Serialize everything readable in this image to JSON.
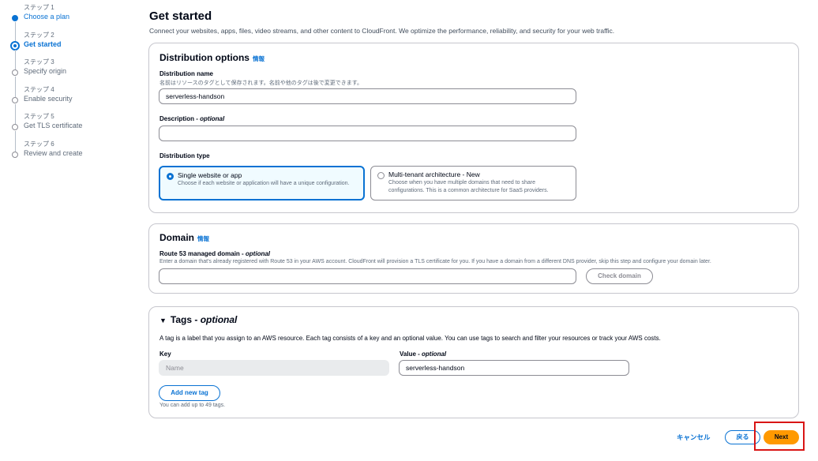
{
  "steps": [
    {
      "num": "ステップ 1",
      "title": "Choose a plan",
      "state": "done"
    },
    {
      "num": "ステップ 2",
      "title": "Get started",
      "state": "active"
    },
    {
      "num": "ステップ 3",
      "title": "Specify origin",
      "state": "todo"
    },
    {
      "num": "ステップ 4",
      "title": "Enable security",
      "state": "todo"
    },
    {
      "num": "ステップ 5",
      "title": "Get TLS certificate",
      "state": "todo"
    },
    {
      "num": "ステップ 6",
      "title": "Review and create",
      "state": "todo"
    }
  ],
  "page": {
    "title": "Get started",
    "description": "Connect your websites, apps, files, video streams, and other content to CloudFront. We optimize the performance, reliability, and security for your web traffic."
  },
  "distribution": {
    "heading": "Distribution options",
    "info": "情報",
    "name_label": "Distribution name",
    "name_hint": "名前はリソースのタグとして保存されます。名前や他のタグは後で変更できます。",
    "name_value": "serverless-handson",
    "description_label": "Description - ",
    "description_optional": "optional",
    "description_value": "",
    "type_label": "Distribution type",
    "type_options": [
      {
        "title": "Single website or app",
        "desc": "Choose if each website or application will have a unique configuration.",
        "selected": true
      },
      {
        "title": "Multi-tenant architecture - New",
        "desc": "Choose when you have multiple domains that need to share configurations. This is a common architecture for SaaS providers.",
        "selected": false
      }
    ]
  },
  "domain": {
    "heading": "Domain",
    "info": "情報",
    "label": "Route 53 managed domain - ",
    "label_optional": "optional",
    "hint": "Enter a domain that's already registered with Route 53 in your AWS account. CloudFront will provision a TLS certificate for you. If you have a domain from a different DNS provider, skip this step and configure your domain later.",
    "value": "",
    "check_button": "Check domain"
  },
  "tags": {
    "heading": "Tags - ",
    "heading_optional": "optional",
    "description": "A tag is a label that you assign to an AWS resource. Each tag consists of a key and an optional value. You can use tags to search and filter your resources or track your AWS costs.",
    "key_label": "Key",
    "value_label": "Value - ",
    "value_optional": "optional",
    "key_placeholder": "Name",
    "value_value": "serverless-handson",
    "add_button": "Add new tag",
    "limit_note": "You can add up to 49 tags."
  },
  "footer": {
    "cancel": "キャンセル",
    "back": "戻る",
    "next": "Next"
  },
  "colors": {
    "accent": "#0972d3",
    "primary_button": "#ff9900",
    "highlight_box": "#d91515"
  }
}
